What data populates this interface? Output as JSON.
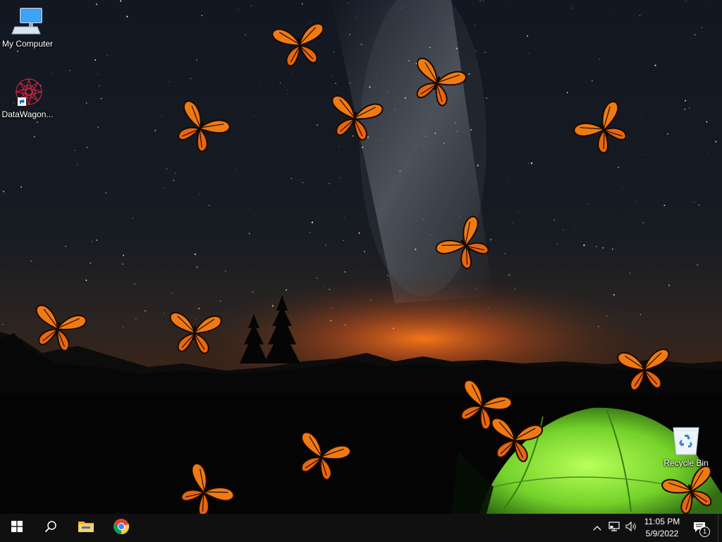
{
  "desktop": {
    "icons": [
      {
        "label": "My Computer",
        "icon": "computer-icon"
      },
      {
        "label": "DataWagon...",
        "icon": "datawagon-icon"
      },
      {
        "label": "Recycle Bin",
        "icon": "recycle-bin-icon"
      }
    ],
    "wallpaper": {
      "description_icon": "night-sky-camping-wallpaper",
      "accent": "#ff7a1a",
      "tent_color": "#7ee032"
    }
  },
  "taskbar": {
    "start": {
      "icon": "windows-start-icon"
    },
    "search": {
      "icon": "search-icon"
    },
    "pinned": [
      {
        "icon": "file-explorer-icon"
      },
      {
        "icon": "chrome-icon"
      }
    ],
    "tray": {
      "chevron": {
        "icon": "chevron-up-icon"
      },
      "network": {
        "icon": "network-icon"
      },
      "volume": {
        "icon": "volume-icon"
      },
      "time": "11:05 PM",
      "date": "5/9/2022",
      "notifications": {
        "icon": "notification-icon",
        "count": "1"
      }
    }
  }
}
